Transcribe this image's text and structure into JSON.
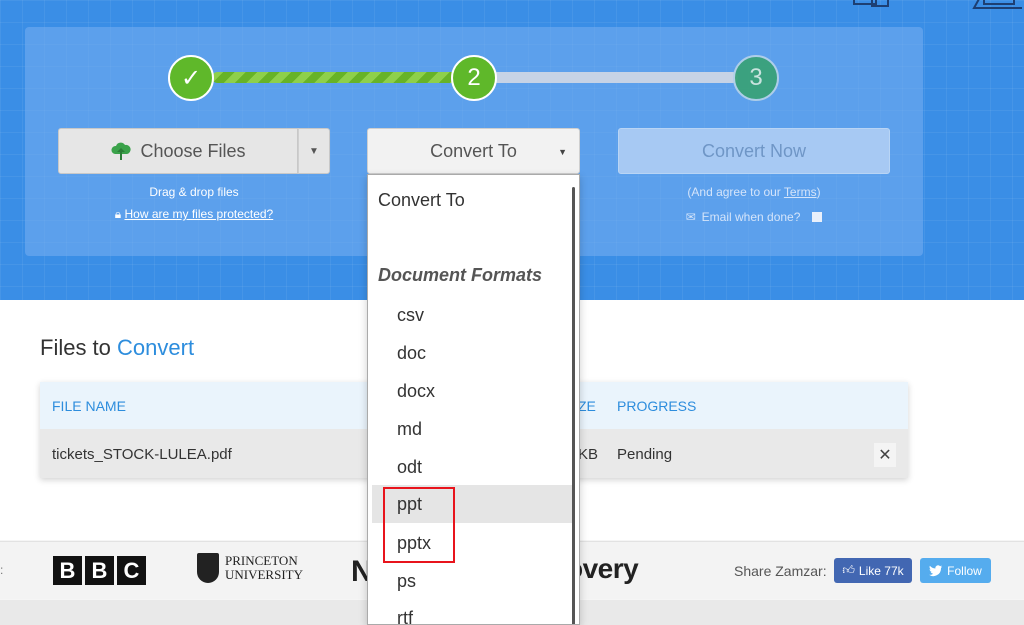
{
  "steps": [
    {
      "label": "✓",
      "state": "done"
    },
    {
      "label": "2",
      "state": "active"
    },
    {
      "label": "3",
      "state": "pending"
    }
  ],
  "choose_files": {
    "label": "Choose Files"
  },
  "drag_text": "Drag & drop files",
  "protected_link": "How are my files protected?",
  "convert_to": {
    "label": "Convert To"
  },
  "convert_now": {
    "label": "Convert Now"
  },
  "agree": {
    "prefix": "(And agree to our ",
    "link": "Terms",
    "suffix": ")"
  },
  "email_label": "Email when done?",
  "files": {
    "title_prefix": "Files to ",
    "title_accent": "Convert",
    "headers": {
      "name": "FILE NAME",
      "size": "ZE",
      "progress": "PROGRESS"
    },
    "rows": [
      {
        "name": "tickets_STOCK-LULEA.pdf",
        "size": "KB",
        "progress": "Pending"
      }
    ]
  },
  "dropdown": {
    "header": "Convert To",
    "group": "Document Formats",
    "options": [
      "csv",
      "doc",
      "docx",
      "md",
      "odt",
      "ppt",
      "pptx",
      "ps",
      "rtf"
    ],
    "hovered": "ppt"
  },
  "footer": {
    "colon": ":",
    "bbc": [
      "B",
      "B",
      "C"
    ],
    "princeton_line1": "PRINCETON",
    "princeton_line2": "UNIVERSITY",
    "n_logo": "N",
    "discovery": "overy",
    "share": "Share Zamzar:",
    "fb_like": "Like 77k",
    "tw_follow": "Follow"
  },
  "colors": {
    "brand_blue": "#3a8ee6",
    "step_green": "#5fb82a",
    "highlight_red": "#e8141c",
    "link_blue": "#2d8ddd"
  }
}
